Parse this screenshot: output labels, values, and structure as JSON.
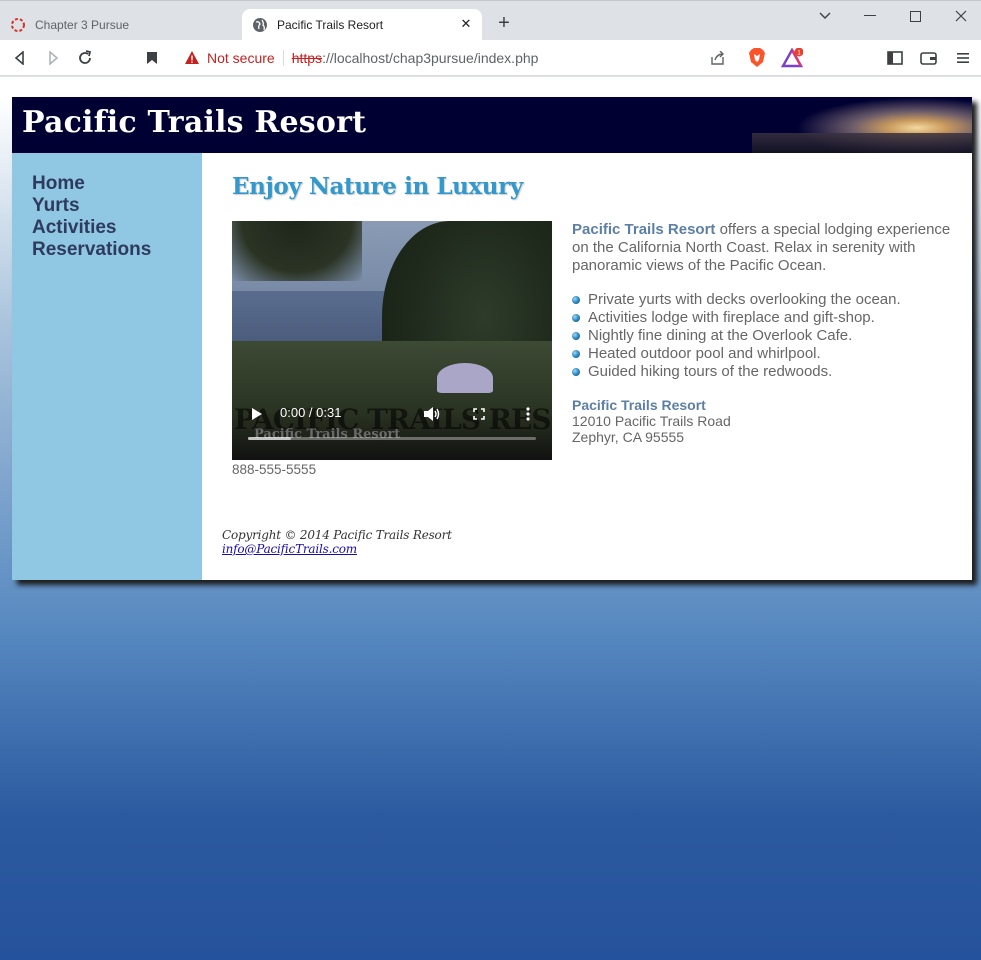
{
  "browser": {
    "tabs": [
      {
        "title": "Chapter 3 Pursue",
        "active": false
      },
      {
        "title": "Pacific Trails Resort",
        "active": true
      }
    ],
    "new_tab_icon": "plus-icon",
    "security_label": "Not secure",
    "url_scheme": "https",
    "url_rest": "://localhost/chap3pursue/index.php"
  },
  "site": {
    "title": "Pacific Trails Resort",
    "nav": [
      "Home",
      "Yurts",
      "Activities",
      "Reservations"
    ],
    "heading": "Enjoy Nature in Luxury",
    "video": {
      "time": "0:00 / 0:31",
      "watermark": "PACIFIC TRAILS RESORT",
      "watermark_small": "Pacific Trails Resort",
      "progress": 0.15
    },
    "phone": "888-555-5555",
    "intro_brand": "Pacific Trails Resort",
    "intro_text": " offers a special lodging experience on the California North Coast. Relax in serenity with panoramic views of the Pacific Ocean.",
    "features": [
      "Private yurts with decks overlooking the ocean.",
      "Activities lodge with fireplace and gift-shop.",
      "Nightly fine dining at the Overlook Cafe.",
      "Heated outdoor pool and whirlpool.",
      "Guided hiking tours of the redwoods."
    ],
    "address": {
      "name": "Pacific Trails Resort",
      "street": "12010 Pacific Trails Road",
      "city": "Zephyr, CA 95555"
    },
    "footer": {
      "copyright": "Copyright © 2014 Pacific Trails Resort",
      "email": "info@PacificTrails.com"
    }
  },
  "colors": {
    "header_bg": "#000033",
    "nav_bg": "#90c7e3",
    "heading": "#3399cc",
    "nav_text": "#2e3b5e"
  }
}
